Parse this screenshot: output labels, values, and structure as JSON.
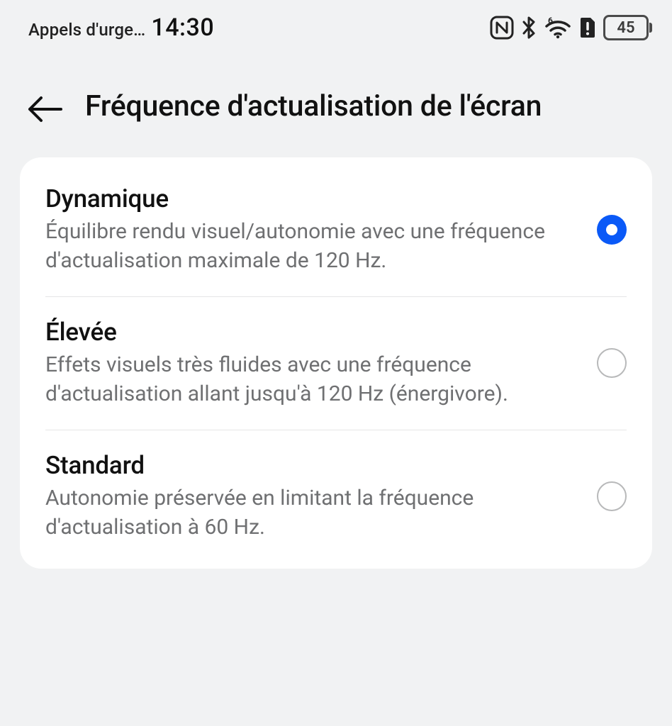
{
  "statusbar": {
    "carrier": "Appels d'urge…",
    "time": "14:30",
    "battery": "45",
    "icons": {
      "nfc": "nfc-icon",
      "bluetooth": "bluetooth-icon",
      "wifi": "wifi-6-icon",
      "sim_alert": "sim-alert-icon",
      "battery": "battery-icon"
    }
  },
  "header": {
    "title": "Fréquence d'actualisation de l'écran"
  },
  "options": [
    {
      "title": "Dynamique",
      "desc": "Équilibre rendu visuel/autonomie avec une fréquence d'actualisation maximale de 120 Hz.",
      "selected": true
    },
    {
      "title": "Élevée",
      "desc": "Effets visuels très fluides avec une fréquence d'actualisation allant jusqu'à 120 Hz (énergivore).",
      "selected": false
    },
    {
      "title": "Standard",
      "desc": "Autonomie préservée en limitant la fréquence d'actualisation à 60 Hz.",
      "selected": false
    }
  ]
}
